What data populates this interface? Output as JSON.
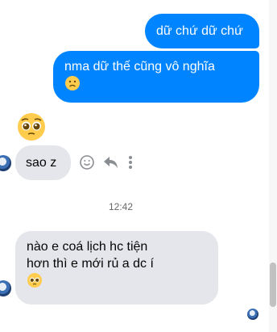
{
  "messages": [
    {
      "direction": "outgoing",
      "text": "dữ chứ dữ chứ"
    },
    {
      "direction": "outgoing",
      "text_line1": "nma dữ thế cũng vô nghĩa",
      "emoji": "frowning-face-icon"
    },
    {
      "direction": "incoming",
      "emoji_only": "pleading-face-icon"
    },
    {
      "direction": "incoming",
      "text": "sao z"
    },
    {
      "direction": "incoming",
      "text_line1": "nào e coá lịch hc tiện",
      "text_line2": "hơn thì e mới rủ a dc í",
      "emoji": "pleading-face-icon"
    }
  ],
  "timestamp": "12:42",
  "colors": {
    "outgoing_bubble": "#0084ff",
    "incoming_bubble": "#e4e6eb",
    "timestamp_text": "#65676b"
  },
  "actions": [
    "smiley-react-icon",
    "reply-arrow-icon",
    "more-vertical-icon"
  ]
}
